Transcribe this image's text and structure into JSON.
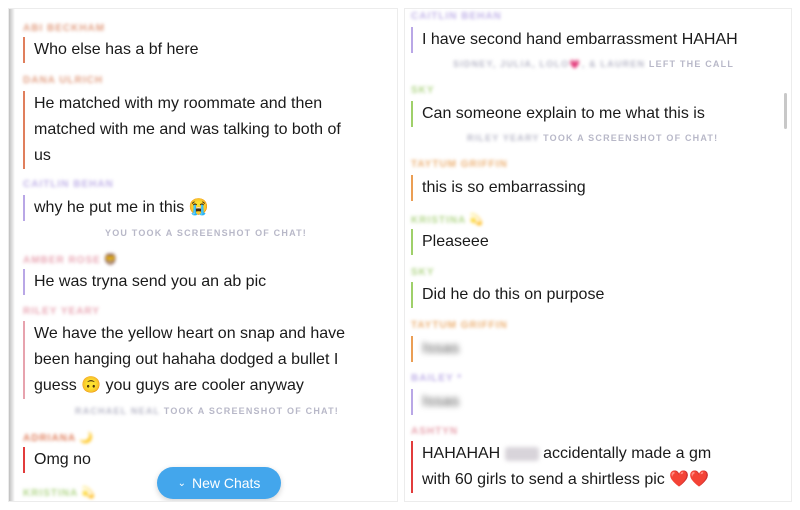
{
  "left": {
    "items": [
      {
        "type": "name",
        "text": "ABI BECKHAM",
        "color": "#e2a084"
      },
      {
        "type": "msg",
        "lines": [
          "Who else has a bf here"
        ],
        "bar": "#e07f5d"
      },
      {
        "type": "name",
        "text": "DANA ULRICH",
        "color": "#e2a084"
      },
      {
        "type": "msg",
        "lines": [
          "He matched with my roommate and then",
          "matched with me and was talking to both of",
          "us"
        ],
        "bar": "#e07f5d"
      },
      {
        "type": "name",
        "text": "CAITLIN BEHAN",
        "color": "#c1b3e8"
      },
      {
        "type": "msg",
        "lines": [
          "why he put me in this 😭"
        ],
        "bar": "#b9a7e6"
      },
      {
        "type": "sys",
        "text": "YOU TOOK A SCREENSHOT OF CHAT!"
      },
      {
        "type": "name",
        "text": "AMBER ROSE",
        "color": "#e9a8b5",
        "emoji": "🦁"
      },
      {
        "type": "msg",
        "lines": [
          "He was tryna send you an ab pic"
        ],
        "bar": "#b9a7e6"
      },
      {
        "type": "name",
        "text": "RILEY YEARY",
        "color": "#e9a8b5"
      },
      {
        "type": "msg",
        "lines": [
          "We have the yellow heart on snap and have",
          "been hanging out hahaha dodged a bullet I",
          "guess 🙃 you guys are cooler anyway"
        ],
        "bar": "#e7a3ae"
      },
      {
        "type": "sys",
        "blurred": "RACHAEL NEAL",
        "text": "TOOK A SCREENSHOT OF CHAT!"
      },
      {
        "type": "name",
        "text": "ADRIANA",
        "color": "#e07f5d",
        "emoji": "🌙"
      },
      {
        "type": "msg",
        "lines": [
          "Omg no"
        ],
        "bar": "#e23c3c"
      },
      {
        "type": "name",
        "text": "KRISTINA",
        "color": "#b2d68a",
        "emoji": "💫"
      }
    ],
    "new_chats_label": "New Chats"
  },
  "right": {
    "items": [
      {
        "type": "name",
        "text": "CAITLIN BEHAN",
        "color": "#c1b3e8"
      },
      {
        "type": "msg",
        "lines": [
          "I have second hand embarrassment HAHAH"
        ],
        "bar": "#b9a7e6"
      },
      {
        "type": "sys",
        "blurred": "SIDNEY, JULIA, LOLO💗, & LAUREN",
        "text": "LEFT THE CALL"
      },
      {
        "type": "name",
        "text": "SKY",
        "color": "#b2d68a"
      },
      {
        "type": "msg",
        "lines": [
          "Can someone explain to me what this is"
        ],
        "bar": "#9fd06a"
      },
      {
        "type": "sys",
        "blurred": "RILEY YEARY",
        "text": "TOOK A SCREENSHOT OF CHAT!"
      },
      {
        "type": "name",
        "text": "TAYTUM GRIFFIN",
        "color": "#ecb175"
      },
      {
        "type": "msg",
        "lines": [
          "this is so embarrassing"
        ],
        "bar": "#eb9e54"
      },
      {
        "type": "name",
        "text": "KRISTINA",
        "color": "#b2d68a",
        "emoji": "💫"
      },
      {
        "type": "msg",
        "lines": [
          "Pleaseee"
        ],
        "bar": "#9fd06a"
      },
      {
        "type": "name",
        "text": "SKY",
        "color": "#b2d68a"
      },
      {
        "type": "msg",
        "lines": [
          "Did he do this on purpose"
        ],
        "bar": "#9fd06a"
      },
      {
        "type": "name",
        "text": "TAYTUM GRIFFIN",
        "color": "#ecb175"
      },
      {
        "type": "blurmsg",
        "text": "Issas",
        "bar": "#eb9e54"
      },
      {
        "type": "name",
        "text": "BAILEY *",
        "color": "#c1b3e8"
      },
      {
        "type": "blurmsg",
        "text": "Issas",
        "bar": "#b9a7e6"
      },
      {
        "type": "name",
        "text": "ASHTYN",
        "color": "#e7a3ae"
      },
      {
        "type": "msg",
        "lines": [
          "HAHAHAH [blurred] accidentally made a gm",
          "with 60 girls to send a shirtless pic ❤️❤️"
        ],
        "bar": "#e23c3c"
      }
    ]
  }
}
